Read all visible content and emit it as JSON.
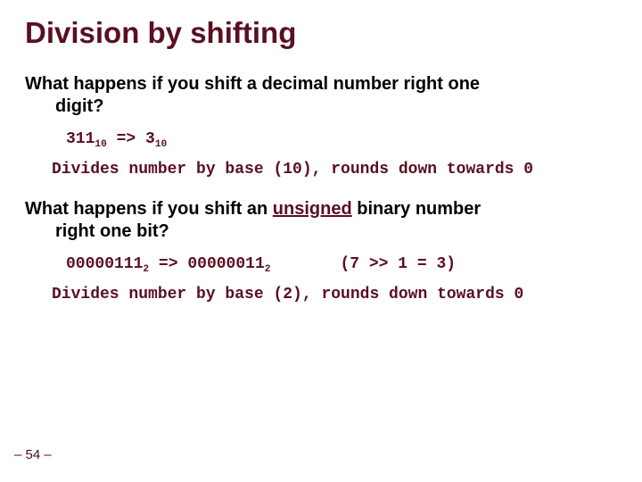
{
  "title": "Division by shifting",
  "q1_line1": "What happens if you shift a decimal number right one",
  "q1_line2": "digit?",
  "ex1_a": "311",
  "ex1_a_sub": "10",
  "ex1_arrow": " => ",
  "ex1_b": "3",
  "ex1_b_sub": "10",
  "desc1": "Divides number by base (10), rounds down towards 0",
  "q2_pre": "What happens if you shift an ",
  "q2_unsigned": "unsigned",
  "q2_post1": " binary number",
  "q2_line2": "right one bit?",
  "ex2_a": "00000111",
  "ex2_a_sub": "2",
  "ex2_arrow": " => ",
  "ex2_b": "00000011",
  "ex2_b_sub": "2",
  "ex2_paren": "(7 >> 1 = 3)",
  "desc2": "Divides number by base (2), rounds down towards 0",
  "pagenum": "– 54 –"
}
